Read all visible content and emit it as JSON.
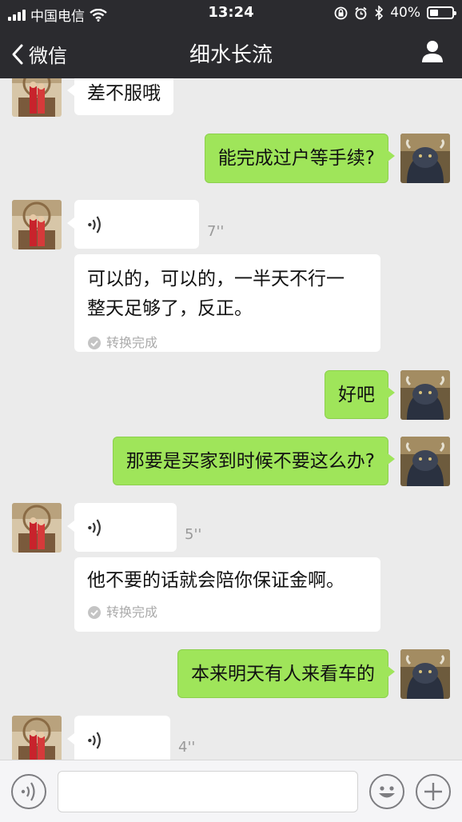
{
  "status_bar": {
    "carrier": "中国电信",
    "time": "13:24",
    "battery": "40%",
    "battery_level": 0.4
  },
  "nav": {
    "back_label": "微信",
    "title": "细水长流"
  },
  "messages": [
    {
      "from": "them",
      "type": "text",
      "text": "差不服哦"
    },
    {
      "from": "me",
      "type": "text",
      "text": "能完成过户等手续?"
    },
    {
      "from": "them",
      "type": "voice",
      "duration": "7''",
      "transcript_lines": [
        "可以的，可以的，一半天不行一",
        "整天足够了，反正。"
      ],
      "status": "转换完成"
    },
    {
      "from": "me",
      "type": "text",
      "text": "好吧"
    },
    {
      "from": "me",
      "type": "text",
      "text": "那要是买家到时候不要这么办?"
    },
    {
      "from": "them",
      "type": "voice",
      "duration": "5''",
      "transcript_lines": [
        "他不要的话就会陪你保证金啊。"
      ],
      "status": "转换完成"
    },
    {
      "from": "me",
      "type": "text",
      "text": "本来明天有人来看车的"
    },
    {
      "from": "them",
      "type": "voice",
      "duration": "4''"
    }
  ],
  "colors": {
    "header_bg": "#2b2b2f",
    "chat_bg": "#ebebeb",
    "outgoing_bubble": "#9fe55a",
    "incoming_bubble": "#ffffff"
  },
  "icons": {
    "back": "chevron-left-icon",
    "profile": "person-icon",
    "voice": "voice-wave-icon",
    "converted": "check-circle-icon",
    "emoji": "smiley-icon",
    "more": "plus-icon"
  }
}
